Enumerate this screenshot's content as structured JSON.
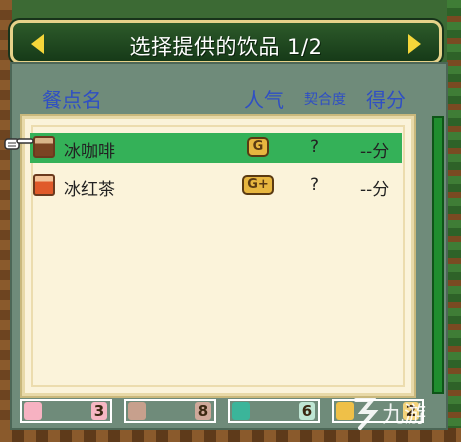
{
  "header": {
    "title": "选择提供的饮品 1/2"
  },
  "columns": {
    "name": "餐点名",
    "popularity": "人气",
    "fit": "契合度",
    "score": "得分"
  },
  "items": [
    {
      "name": "冰咖啡",
      "popularity": "G",
      "fit": "?",
      "score": "--分",
      "icon": "iced-coffee-icon",
      "selected": true
    },
    {
      "name": "冰红茶",
      "popularity": "G+",
      "fit": "?",
      "score": "--分",
      "icon": "iced-tea-icon",
      "selected": false
    }
  ],
  "resources": [
    {
      "icon": "pink-face-icon",
      "value": "3",
      "color": "#f6b7c3"
    },
    {
      "icon": "brown-face-icon",
      "value": "8",
      "color": "#cfa89a"
    },
    {
      "icon": "teal-leaf-icon",
      "value": "6",
      "color": "#bfe6d4"
    },
    {
      "icon": "gold-star-icon",
      "value": "2",
      "color": "#f4d37a"
    }
  ],
  "watermark": {
    "text": "九游"
  },
  "colors": {
    "header_bg": "#1f4a22",
    "header_border": "#e6d28a",
    "arrow": "#f5d63a",
    "column_header": "#2f4fc4",
    "selected_row": "#34b158",
    "list_bg": "#fbf3da",
    "scrollbar": "#1f8d2e"
  }
}
